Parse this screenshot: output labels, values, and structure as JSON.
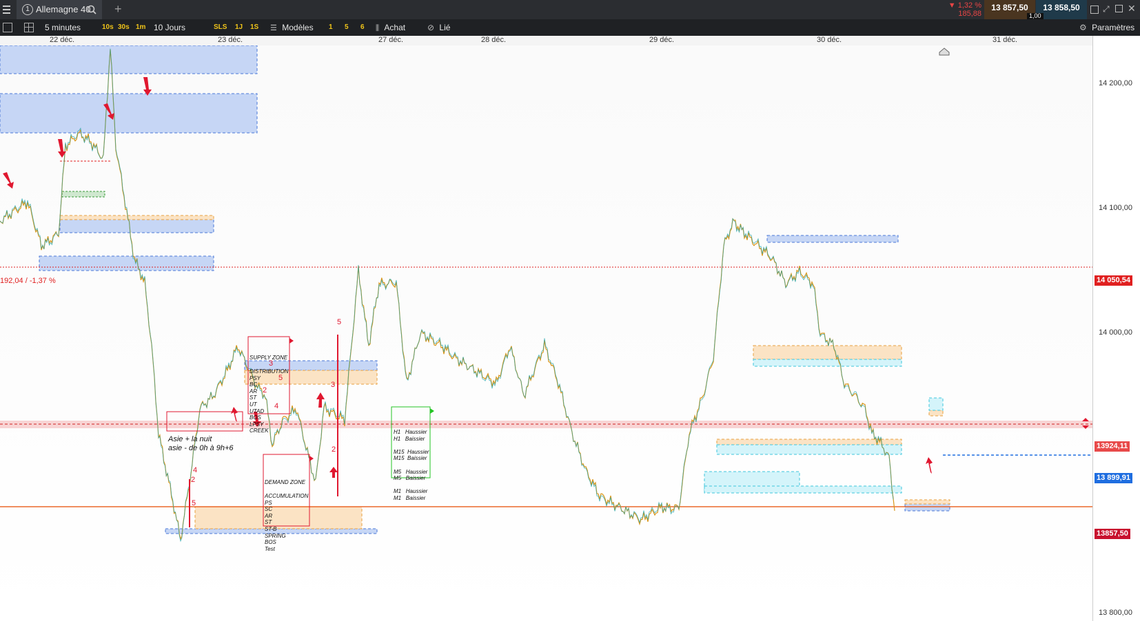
{
  "topbar": {
    "instrument": "Allemagne 40",
    "tab_number": "1",
    "add_tab": "+",
    "change_pct": "▼ 1,32 %",
    "change_abs": "185,88",
    "bid": "13 857,50",
    "ask": "13 858,50",
    "spread": "1,00"
  },
  "toolbar": {
    "timeframe": "5 minutes",
    "tf_10s": "10s",
    "tf_30s": "30s",
    "tf_1m": "1m",
    "period": "10 Jours",
    "sls": "SLS",
    "q_1j": "1J",
    "q_1s": "1S",
    "models": "Modèles",
    "m1": "1",
    "m5": "5",
    "m6": "6",
    "buy": "Achat",
    "linked": "Lié",
    "settings": "Paramètres"
  },
  "dates": [
    "22 déc.",
    "23 déc.",
    "27 déc.",
    "28 déc.",
    "29 déc.",
    "30 déc.",
    "31 déc."
  ],
  "axis": {
    "ticks": [
      "14 200,00",
      "14 100,00",
      "14 000,00",
      "13 800,00"
    ],
    "tag_red": "14 050,54",
    "tag_pink": "13924,11",
    "tag_blue": "13 899,91",
    "tag_orange": "13857,50"
  },
  "annotations": {
    "prev_close": "192,04 / -1,37 %",
    "asia_note": "Asie + la nuit\nasie - de 0h à 9h+6",
    "supply_title": "SUPPLY ZONE",
    "supply_lines": "DISTRIBUTION\nPSY\nBC\nAR\nST\nUT\nUTAD\nBOS\nLPSY\nCREEK",
    "demand_title": "DEMAND ZONE",
    "demand_lines": "ACCUMULATION\nPS\nSC\nAR\nST\nST-B\nSPRING\nBOS\nTest",
    "trend_table": "H1   Haussier\nH1   Baissier\n\nM15  Haussier\nM15  Baissier\n\nM5   Haussier\nM5   Baissier\n\nM1   Haussier\nM1   Baissier",
    "wave_labels": [
      "5",
      "3",
      "5",
      "2",
      "4",
      "4",
      "2",
      "5",
      "3",
      "2"
    ]
  },
  "chart_data": {
    "type": "line",
    "instrument": "Allemagne 40",
    "timeframe": "5 minutes",
    "x_labels": [
      "22 déc.",
      "23 déc.",
      "27 déc.",
      "28 déc.",
      "29 déc.",
      "30 déc.",
      "31 déc."
    ],
    "y_ticks": [
      14200,
      14100,
      14000,
      13800
    ],
    "ylim": [
      13780,
      14230
    ],
    "lines": {
      "14 050,54": 14050.54,
      "13924,11": 13924.11,
      "13 899,91": 13899.91,
      "13857,50": 13857.5
    },
    "price_path": [
      [
        0,
        14090
      ],
      [
        40,
        14105
      ],
      [
        60,
        14070
      ],
      [
        85,
        14080
      ],
      [
        95,
        14150
      ],
      [
        115,
        14160
      ],
      [
        130,
        14155
      ],
      [
        150,
        14140
      ],
      [
        160,
        14230
      ],
      [
        168,
        14150
      ],
      [
        180,
        14110
      ],
      [
        195,
        14060
      ],
      [
        210,
        14040
      ],
      [
        220,
        13990
      ],
      [
        230,
        13920
      ],
      [
        245,
        13880
      ],
      [
        262,
        13835
      ],
      [
        275,
        13880
      ],
      [
        290,
        13940
      ],
      [
        310,
        13950
      ],
      [
        330,
        13970
      ],
      [
        345,
        13990
      ],
      [
        370,
        13960
      ],
      [
        385,
        13950
      ],
      [
        395,
        13910
      ],
      [
        410,
        13930
      ],
      [
        430,
        13940
      ],
      [
        448,
        13900
      ],
      [
        458,
        13880
      ],
      [
        470,
        13940
      ],
      [
        500,
        13930
      ],
      [
        520,
        14050
      ],
      [
        535,
        13990
      ],
      [
        550,
        14040
      ],
      [
        575,
        14040
      ],
      [
        590,
        13960
      ],
      [
        610,
        14000
      ],
      [
        640,
        13990
      ],
      [
        660,
        13980
      ],
      [
        690,
        13970
      ],
      [
        720,
        13960
      ],
      [
        740,
        13990
      ],
      [
        760,
        13950
      ],
      [
        790,
        13990
      ],
      [
        810,
        13960
      ],
      [
        830,
        13920
      ],
      [
        850,
        13890
      ],
      [
        870,
        13870
      ],
      [
        900,
        13860
      ],
      [
        930,
        13850
      ],
      [
        960,
        13860
      ],
      [
        985,
        13860
      ],
      [
        1000,
        13920
      ],
      [
        1020,
        13950
      ],
      [
        1035,
        13980
      ],
      [
        1050,
        14070
      ],
      [
        1065,
        14090
      ],
      [
        1080,
        14080
      ],
      [
        1100,
        14070
      ],
      [
        1120,
        14060
      ],
      [
        1140,
        14040
      ],
      [
        1160,
        14050
      ],
      [
        1180,
        14040
      ],
      [
        1190,
        14000
      ],
      [
        1210,
        13990
      ],
      [
        1225,
        13960
      ],
      [
        1240,
        13950
      ],
      [
        1255,
        13940
      ],
      [
        1265,
        13920
      ],
      [
        1280,
        13910
      ],
      [
        1290,
        13900
      ],
      [
        1298,
        13857.5
      ]
    ]
  }
}
